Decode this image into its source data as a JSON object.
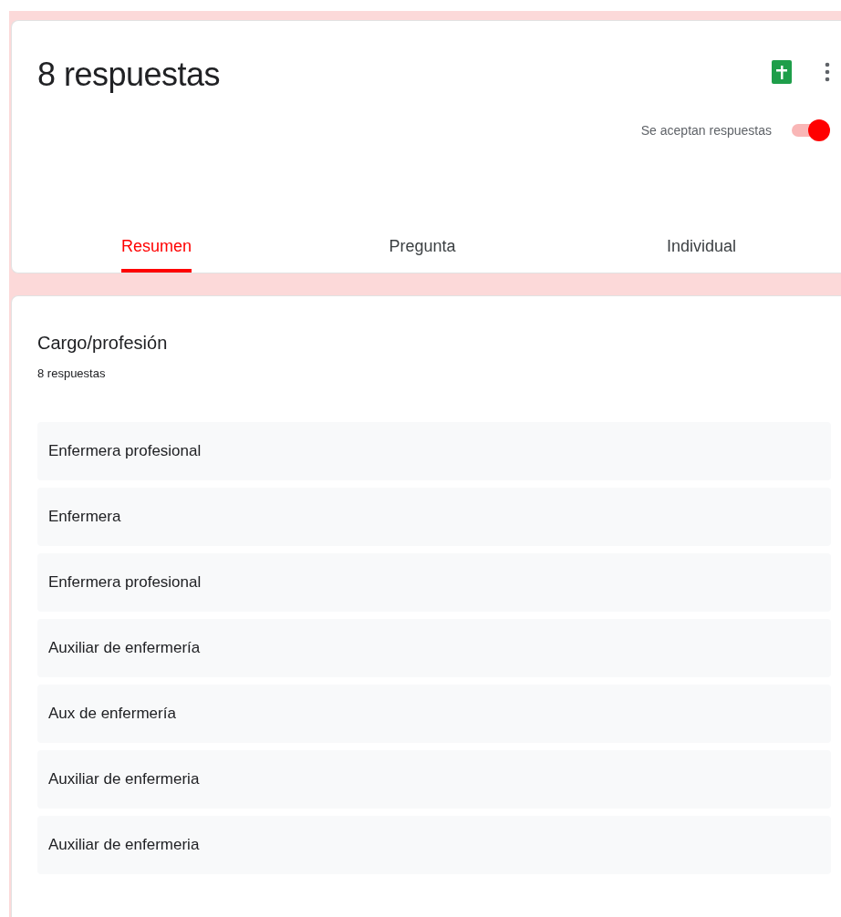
{
  "header": {
    "title": "8 respuestas",
    "accepting": {
      "label": "Se aceptan respuestas",
      "on": true
    }
  },
  "tabs": [
    {
      "label": "Resumen",
      "selected": true
    },
    {
      "label": "Pregunta",
      "selected": false
    },
    {
      "label": "Individual",
      "selected": false
    }
  ],
  "question": {
    "title": "Cargo/profesión",
    "count": "8 respuestas",
    "answers": [
      "Enfermera profesional",
      "Enfermera",
      "Enfermera profesional",
      "Auxiliar de enfermería",
      "Aux de enfermería",
      "Auxiliar de enfermeria",
      "Auxiliar de enfermeria"
    ]
  }
}
